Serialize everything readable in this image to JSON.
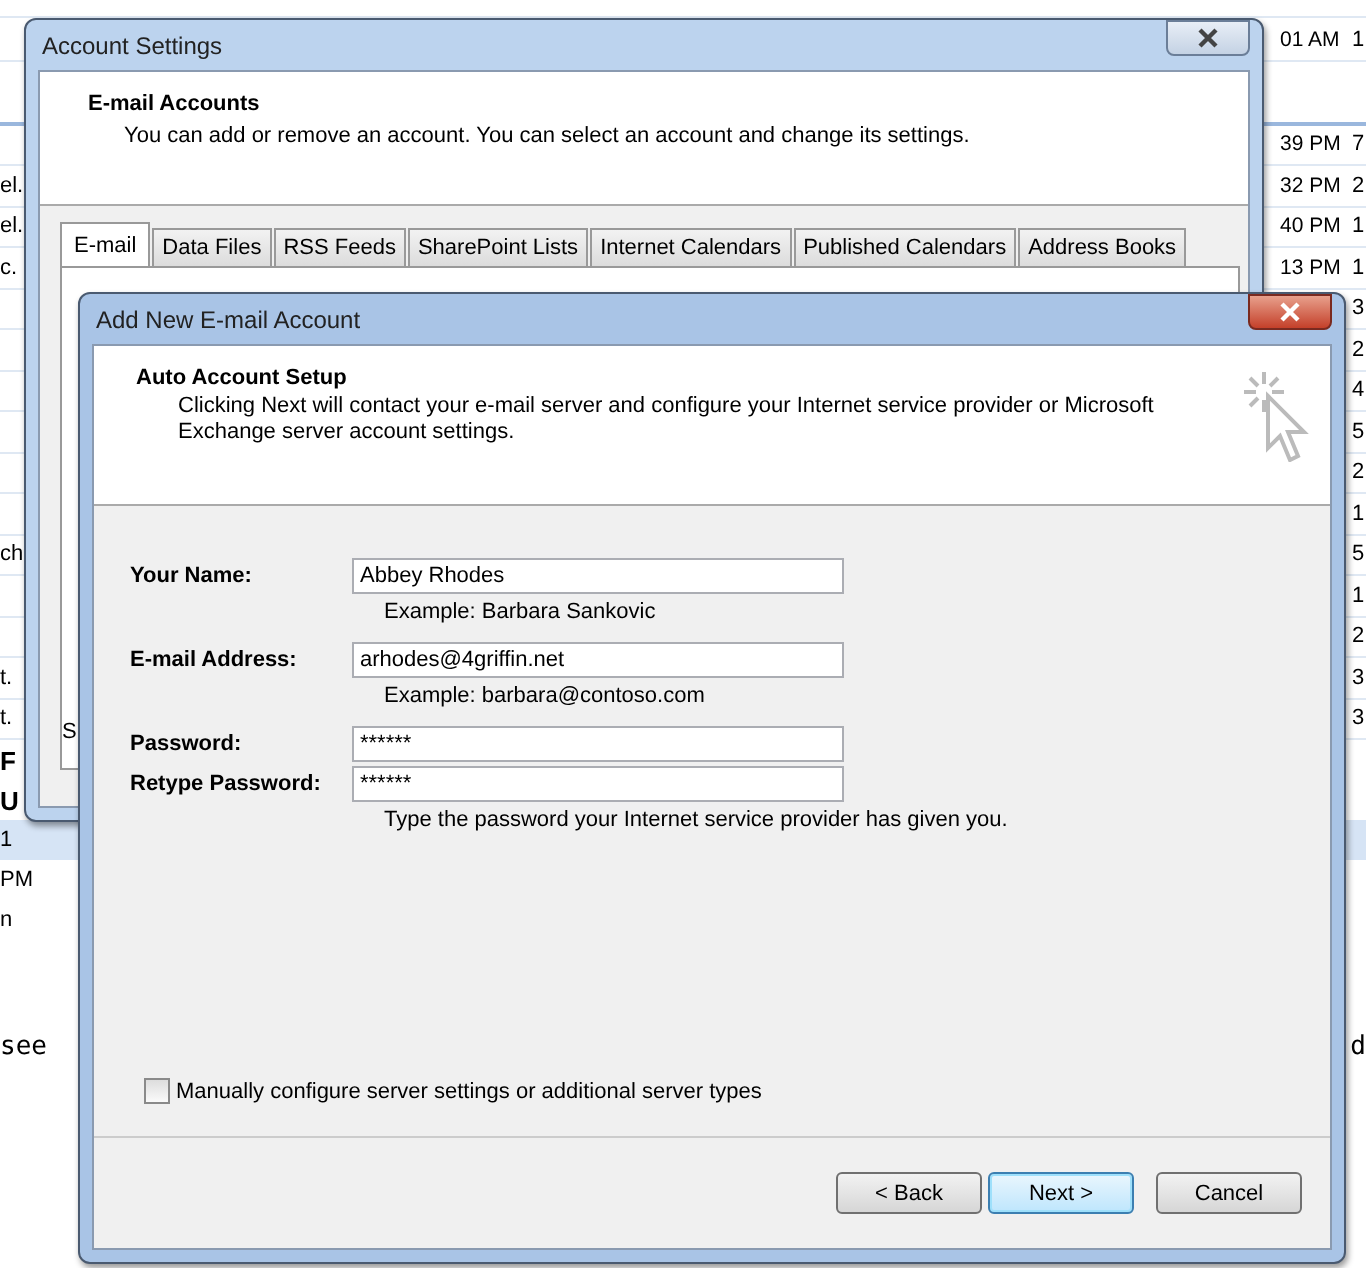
{
  "background": {
    "rows": [
      {
        "left": "",
        "time": "01 AM",
        "count": "1"
      },
      {
        "left": "",
        "time": "",
        "count": ""
      },
      {
        "left": "",
        "time": "39 PM",
        "count": "7"
      },
      {
        "left": "el.",
        "time": "32 PM",
        "count": "2"
      },
      {
        "left": "el.",
        "time": "40 PM",
        "count": "1"
      },
      {
        "left": "c.",
        "time": "13 PM",
        "count": "1"
      },
      {
        "left": "",
        "time": "",
        "count": "3"
      },
      {
        "left": "",
        "time": "",
        "count": "2"
      },
      {
        "left": "",
        "time": "",
        "count": "4"
      },
      {
        "left": "",
        "time": "",
        "count": "5"
      },
      {
        "left": "",
        "time": "",
        "count": "2"
      },
      {
        "left": "",
        "time": "",
        "count": "1"
      },
      {
        "left": "ch",
        "time": "",
        "count": "5"
      },
      {
        "left": "",
        "time": "",
        "count": "1"
      },
      {
        "left": "",
        "time": "",
        "count": "2"
      },
      {
        "left": "t.",
        "time": "",
        "count": "3"
      },
      {
        "left": "t.",
        "time": "",
        "count": "3"
      }
    ],
    "pane": [
      {
        "text": "F",
        "kind": "heading"
      },
      {
        "text": "U",
        "kind": "heading"
      },
      {
        "text": "1",
        "kind": "selected"
      },
      {
        "text": "PM",
        "kind": "plain"
      },
      {
        "text": "n",
        "kind": "plain"
      }
    ],
    "body_left": "see",
    "body_right": "d"
  },
  "account_settings": {
    "title": "Account Settings",
    "heading": "E-mail Accounts",
    "description": "You can add or remove an account. You can select an account and change its settings.",
    "tabs": [
      {
        "label": "E-mail",
        "selected": true
      },
      {
        "label": "Data Files",
        "selected": false
      },
      {
        "label": "RSS Feeds",
        "selected": false
      },
      {
        "label": "SharePoint Lists",
        "selected": false
      },
      {
        "label": "Internet Calendars",
        "selected": false
      },
      {
        "label": "Published Calendars",
        "selected": false
      },
      {
        "label": "Address Books",
        "selected": false
      }
    ],
    "status_fragment": "S"
  },
  "add_account": {
    "title": "Add New E-mail Account",
    "heading": "Auto Account Setup",
    "description": "Clicking Next will contact your e-mail server and configure your Internet service provider or Microsoft Exchange server account settings.",
    "fields": [
      {
        "label": "Your Name:",
        "value": "Abbey Rhodes",
        "hint": "Example: Barbara Sankovic"
      },
      {
        "label": "E-mail Address:",
        "value": "arhodes@4griffin.net",
        "hint": "Example: barbara@contoso.com"
      },
      {
        "label": "Password:",
        "value": "******"
      },
      {
        "label": "Retype Password:",
        "value": "******",
        "hint": "Type the password your Internet service provider has given you."
      }
    ],
    "manual_config": {
      "label": "Manually configure server settings or additional server types",
      "checked": false
    },
    "buttons": [
      {
        "label": "< Back",
        "default": false
      },
      {
        "label": "Next >",
        "default": true
      },
      {
        "label": "Cancel",
        "default": false
      }
    ]
  }
}
